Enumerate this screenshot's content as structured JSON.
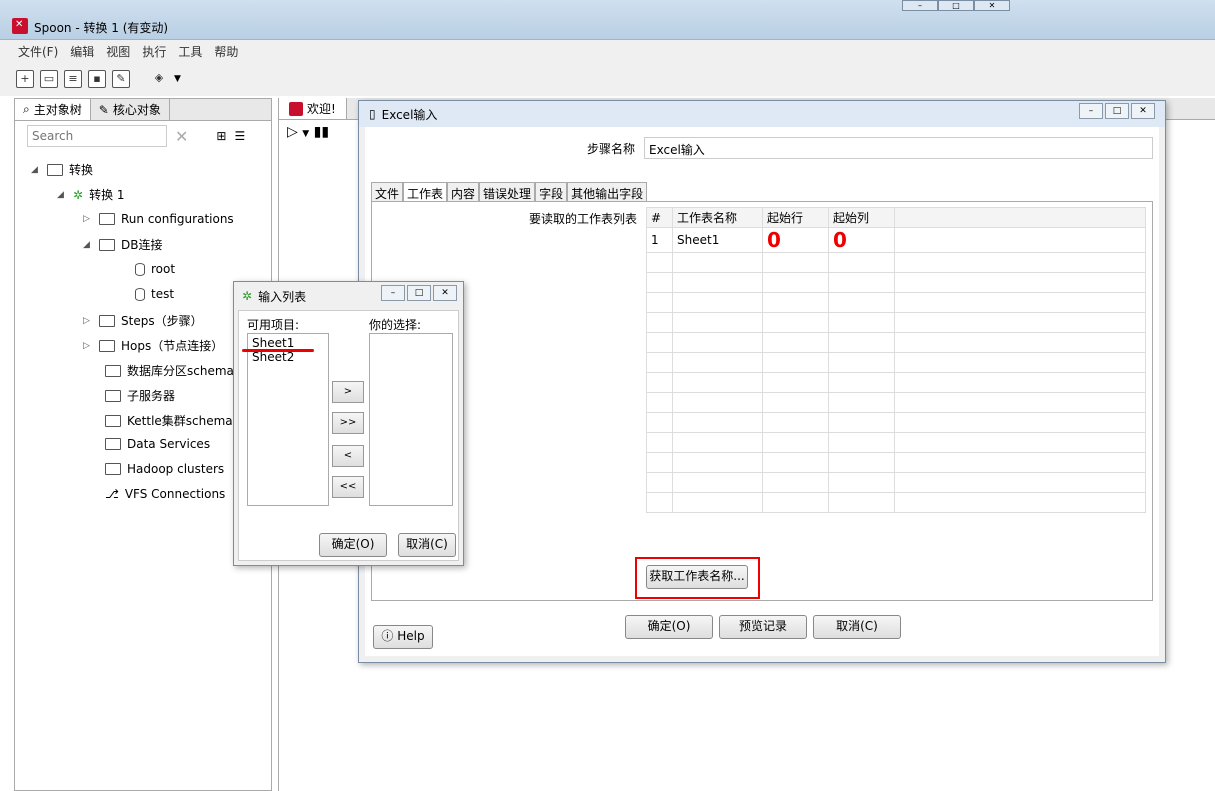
{
  "window": {
    "title": "Spoon - 转换 1 (有变动)"
  },
  "menu": [
    "文件(F)",
    "编辑",
    "视图",
    "执行",
    "工具",
    "帮助"
  ],
  "left": {
    "tabs": [
      "主对象树",
      "核心对象"
    ],
    "search_placeholder": "Search",
    "tree": {
      "root": "转换",
      "trans": "转换 1",
      "run": "Run configurations",
      "db": "DB连接",
      "db_items": [
        "root",
        "test"
      ],
      "steps": "Steps（步骤）",
      "hops": "Hops（节点连接）",
      "partition": "数据库分区schemas",
      "subservers": "子服务器",
      "cluster": "Kettle集群schemas",
      "dataservices": "Data Services",
      "hadoop": "Hadoop clusters",
      "vfs": "VFS Connections"
    }
  },
  "center": {
    "tab": "欢迎!"
  },
  "excel": {
    "title": "Excel输入",
    "step_label": "步骤名称",
    "step_value": "Excel输入",
    "tabs": [
      "文件",
      "工作表",
      "内容",
      "错误处理",
      "字段",
      "其他输出字段"
    ],
    "sheet_list_label": "要读取的工作表列表",
    "columns": [
      "#",
      "工作表名称",
      "起始行",
      "起始列"
    ],
    "rows": [
      {
        "num": "1",
        "name": "Sheet1",
        "row": "0",
        "col": "0"
      }
    ],
    "get_names_button": "获取工作表名称...",
    "ok_button": "确定(O)",
    "preview_button": "预览记录",
    "cancel_button": "取消(C)",
    "help_button": "Help"
  },
  "inputlist": {
    "title": "输入列表",
    "available_label": "可用项目:",
    "selected_label": "你的选择:",
    "available_items": [
      "Sheet1",
      "Sheet2"
    ],
    "move_buttons": [
      ">",
      ">>",
      "<",
      "<<"
    ],
    "ok_button": "确定(O)",
    "cancel_button": "取消(C)"
  }
}
